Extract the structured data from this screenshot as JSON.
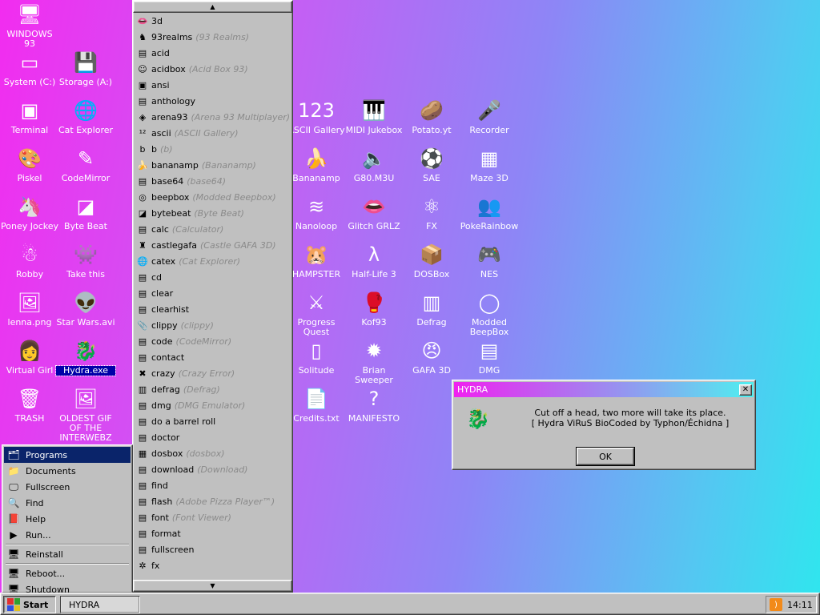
{
  "desktop": {
    "icons": [
      {
        "label": "WINDOWS 93",
        "icon": "computer-icon",
        "glyph": "🖥"
      },
      {
        "label": "System (C:)",
        "icon": "hard-drive-icon",
        "glyph": "▭"
      },
      {
        "label": "Storage (A:)",
        "icon": "floppy-drive-icon",
        "glyph": "💾"
      },
      {
        "label": "Terminal",
        "icon": "terminal-icon",
        "glyph": "▣"
      },
      {
        "label": "Cat Explorer",
        "icon": "globe-cat-icon",
        "glyph": "🌐"
      },
      {
        "label": "Piskel",
        "icon": "palette-icon",
        "glyph": "🎨"
      },
      {
        "label": "CodeMirror",
        "icon": "code-cat-icon",
        "glyph": "✎"
      },
      {
        "label": "Poney Jockey",
        "icon": "pony-icon",
        "glyph": "🦄"
      },
      {
        "label": "Byte Beat",
        "icon": "bytebeat-icon",
        "glyph": "◪"
      },
      {
        "label": "Robby",
        "icon": "stick-figure-icon",
        "glyph": "☃"
      },
      {
        "label": "Take this",
        "icon": "pixel-character-icon",
        "glyph": "👾"
      },
      {
        "label": "lenna.png",
        "icon": "image-file-icon",
        "glyph": "🖼"
      },
      {
        "label": "Star Wars.avi",
        "icon": "yoda-icon",
        "glyph": "👽"
      },
      {
        "label": "Virtual Girl",
        "icon": "virtual-girl-icon",
        "glyph": "👩"
      },
      {
        "label": "Hydra.exe",
        "icon": "hydra-icon",
        "glyph": "🐉"
      },
      {
        "label": "TRASH",
        "icon": "trash-icon",
        "glyph": "🗑"
      },
      {
        "label": "OLDEST GIF OF THE INTERWEBZ",
        "icon": "gif-file-icon",
        "glyph": "🖼"
      },
      {
        "label": "ASCII Gallery",
        "icon": "ascii-icon",
        "glyph": "123"
      },
      {
        "label": "MIDI Jukebox",
        "icon": "piano-icon",
        "glyph": "🎹"
      },
      {
        "label": "Potato.yt",
        "icon": "potato-icon",
        "glyph": "🥔"
      },
      {
        "label": "Recorder",
        "icon": "microphone-icon",
        "glyph": "🎤"
      },
      {
        "label": "Bananamp",
        "icon": "banana-icon",
        "glyph": "🍌"
      },
      {
        "label": "G80.M3U",
        "icon": "playlist-icon",
        "glyph": "🔈"
      },
      {
        "label": "SAE",
        "icon": "amiga-ball-icon",
        "glyph": "⚽"
      },
      {
        "label": "Maze 3D",
        "icon": "maze-icon",
        "glyph": "▦"
      },
      {
        "label": "Nanoloop",
        "icon": "nanoloop-icon",
        "glyph": "≋"
      },
      {
        "label": "Glitch GRLZ",
        "icon": "lips-icon",
        "glyph": "👄"
      },
      {
        "label": "FX",
        "icon": "atom-icon",
        "glyph": "⚛"
      },
      {
        "label": "PokeRainbow",
        "icon": "pokemon-trainers-icon",
        "glyph": "👥"
      },
      {
        "label": "HAMPSTER",
        "icon": "hamster-icon",
        "glyph": "🐹"
      },
      {
        "label": "Half-Life 3",
        "icon": "half-life-icon",
        "glyph": "λ"
      },
      {
        "label": "DOSBox",
        "icon": "dosbox-icon",
        "glyph": "📦"
      },
      {
        "label": "NES",
        "icon": "nes-console-icon",
        "glyph": "🎮"
      },
      {
        "label": "Progress Quest",
        "icon": "swords-icon",
        "glyph": "⚔"
      },
      {
        "label": "Kof93",
        "icon": "fighter-icon",
        "glyph": "🥊"
      },
      {
        "label": "Defrag",
        "icon": "defrag-icon",
        "glyph": "▥"
      },
      {
        "label": "Modded BeepBox",
        "icon": "beepbox-icon",
        "glyph": "◯"
      },
      {
        "label": "Solitude",
        "icon": "solitude-icon",
        "glyph": "▯"
      },
      {
        "label": "Brian Sweeper",
        "icon": "mine-icon",
        "glyph": "✹"
      },
      {
        "label": "GAFA 3D",
        "icon": "doomguy-icon",
        "glyph": "😠"
      },
      {
        "label": "DMG",
        "icon": "gameboy-icon",
        "glyph": "▤"
      },
      {
        "label": "Credits.txt",
        "icon": "text-file-icon",
        "glyph": "📄"
      },
      {
        "label": "MANIFESTO",
        "icon": "question-mark-icon",
        "glyph": "?"
      }
    ]
  },
  "start_menu": {
    "items": [
      {
        "label": "Programs",
        "icon": "programs-icon",
        "glyph": "🗂"
      },
      {
        "label": "Documents",
        "icon": "documents-icon",
        "glyph": "📁"
      },
      {
        "label": "Fullscreen",
        "icon": "fullscreen-icon",
        "glyph": "🖵"
      },
      {
        "label": "Find",
        "icon": "find-icon",
        "glyph": "🔍"
      },
      {
        "label": "Help",
        "icon": "help-icon",
        "glyph": "📕"
      },
      {
        "label": "Run...",
        "icon": "run-icon",
        "glyph": "▶"
      },
      {
        "label": "Reinstall",
        "icon": "reinstall-icon",
        "glyph": "🖥"
      },
      {
        "label": "Reboot...",
        "icon": "reboot-icon",
        "glyph": "🖥"
      },
      {
        "label": "Shutdown",
        "icon": "shutdown-icon",
        "glyph": "🖥"
      }
    ]
  },
  "programs_menu": {
    "scroll_up": "▲",
    "scroll_down": "▼",
    "items": [
      {
        "name": "3d",
        "sub": "",
        "icon": "3d-lips-icon",
        "glyph": "👄"
      },
      {
        "name": "93realms",
        "sub": "(93 Realms)",
        "icon": "realms-icon",
        "glyph": "♞"
      },
      {
        "name": "acid",
        "sub": "",
        "icon": "exe-icon",
        "glyph": "▤"
      },
      {
        "name": "acidbox",
        "sub": "(Acid Box 93)",
        "icon": "smiley-icon",
        "glyph": "☺"
      },
      {
        "name": "ansi",
        "sub": "",
        "icon": "ansi-icon",
        "glyph": "▣"
      },
      {
        "name": "anthology",
        "sub": "",
        "icon": "exe-icon",
        "glyph": "▤"
      },
      {
        "name": "arena93",
        "sub": "(Arena 93 Multiplayer)",
        "icon": "cube-icon",
        "glyph": "◈"
      },
      {
        "name": "ascii",
        "sub": "(ASCII Gallery)",
        "icon": "ascii-small-icon",
        "glyph": "¹²"
      },
      {
        "name": "b",
        "sub": "(b)",
        "icon": "b-icon",
        "glyph": "b"
      },
      {
        "name": "bananamp",
        "sub": "(Bananamp)",
        "icon": "banana-small-icon",
        "glyph": "🍌"
      },
      {
        "name": "base64",
        "sub": "(base64)",
        "icon": "exe-icon",
        "glyph": "▤"
      },
      {
        "name": "beepbox",
        "sub": "(Modded Beepbox)",
        "icon": "beepbox-small-icon",
        "glyph": "◎"
      },
      {
        "name": "bytebeat",
        "sub": "(Byte Beat)",
        "icon": "bytebeat-small-icon",
        "glyph": "◪"
      },
      {
        "name": "calc",
        "sub": "(Calculator)",
        "icon": "exe-icon",
        "glyph": "▤"
      },
      {
        "name": "castlegafa",
        "sub": "(Castle GAFA 3D)",
        "icon": "castle-icon",
        "glyph": "♜"
      },
      {
        "name": "catex",
        "sub": "(Cat Explorer)",
        "icon": "globe-small-icon",
        "glyph": "🌐"
      },
      {
        "name": "cd",
        "sub": "",
        "icon": "exe-icon",
        "glyph": "▤"
      },
      {
        "name": "clear",
        "sub": "",
        "icon": "exe-icon",
        "glyph": "▤"
      },
      {
        "name": "clearhist",
        "sub": "",
        "icon": "exe-icon",
        "glyph": "▤"
      },
      {
        "name": "clippy",
        "sub": "(clippy)",
        "icon": "clippy-icon",
        "glyph": "📎"
      },
      {
        "name": "code",
        "sub": "(CodeMirror)",
        "icon": "exe-icon",
        "glyph": "▤"
      },
      {
        "name": "contact",
        "sub": "",
        "icon": "exe-icon",
        "glyph": "▤"
      },
      {
        "name": "crazy",
        "sub": "(Crazy Error)",
        "icon": "error-icon",
        "glyph": "✖"
      },
      {
        "name": "defrag",
        "sub": "(Defrag)",
        "icon": "defrag-small-icon",
        "glyph": "▥"
      },
      {
        "name": "dmg",
        "sub": "(DMG Emulator)",
        "icon": "exe-icon",
        "glyph": "▤"
      },
      {
        "name": "do a barrel roll",
        "sub": "",
        "icon": "exe-icon",
        "glyph": "▤"
      },
      {
        "name": "doctor",
        "sub": "",
        "icon": "exe-icon",
        "glyph": "▤"
      },
      {
        "name": "dosbox",
        "sub": "(dosbox)",
        "icon": "dosbox-small-icon",
        "glyph": "▦"
      },
      {
        "name": "download",
        "sub": "(Download)",
        "icon": "exe-icon",
        "glyph": "▤"
      },
      {
        "name": "find",
        "sub": "",
        "icon": "exe-icon",
        "glyph": "▤"
      },
      {
        "name": "flash",
        "sub": "(Adobe Pizza Player™)",
        "icon": "exe-icon",
        "glyph": "▤"
      },
      {
        "name": "font",
        "sub": "(Font Viewer)",
        "icon": "exe-icon",
        "glyph": "▤"
      },
      {
        "name": "format",
        "sub": "",
        "icon": "exe-icon",
        "glyph": "▤"
      },
      {
        "name": "fullscreen",
        "sub": "",
        "icon": "exe-icon",
        "glyph": "▤"
      },
      {
        "name": "fx",
        "sub": "",
        "icon": "atom-small-icon",
        "glyph": "✲"
      }
    ]
  },
  "dialog": {
    "title": "HYDRA",
    "close_glyph": "✕",
    "icon": "hydra-dragon-icon",
    "icon_glyph": "🐉",
    "line1": "Cut off a head, two more will take its place.",
    "line2": "[ Hydra ViRuS BioCoded by Typhon/Échidna ]",
    "ok_label": "OK"
  },
  "taskbar": {
    "start_label": "Start",
    "tasks": [
      "HYDRA"
    ],
    "clock": "14:11",
    "tray_icon": "rss-icon",
    "tray_glyph": ")"
  },
  "colors": {
    "menu_highlight": "#0a246a",
    "dialog_title_start": "#f020f0",
    "dialog_title_end": "#4ef0f0"
  }
}
